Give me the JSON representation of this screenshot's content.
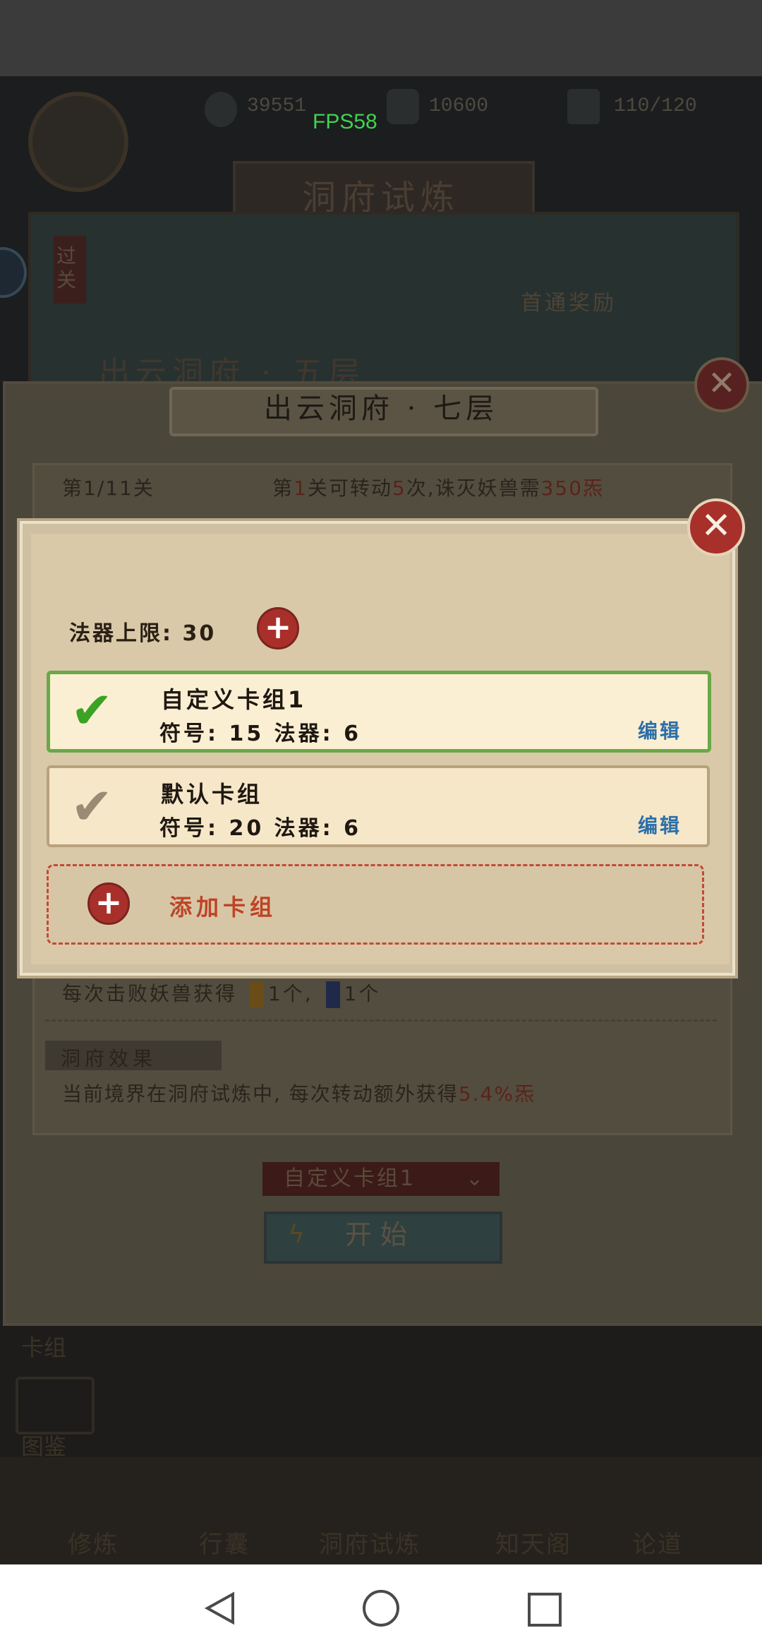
{
  "hud": {
    "fps": "FPS58",
    "spirit_stones": "39551",
    "jade": "10600",
    "stamina": "110/120"
  },
  "background": {
    "title": "洞府试炼",
    "floor_title": "出云洞府 · 五层",
    "first_clear_reward": "首通奖励",
    "side_tag": "过关"
  },
  "trial_dialog": {
    "title": "出云洞府 · 七层",
    "level_counter": "第1/11关",
    "rotate_prefix": "第",
    "rotate_level": "1",
    "rotate_mid": "关可转动",
    "rotate_times": "5",
    "rotate_mid2": "次,诛灭妖兽需",
    "rotate_cost": "350炁",
    "defeat_prefix": "每次击败妖兽获得",
    "defeat_item1": "1个,",
    "defeat_item2": "1个",
    "effect_label": "洞府效果",
    "effect_desc_prefix": "当前境界在洞府试炼中, 每次转动额外获得",
    "effect_desc_value": "5.4%炁",
    "selected_deck": "自定义卡组1",
    "start_label": "开始"
  },
  "bottom_nav": {
    "side_items": [
      "卡组",
      "图鉴"
    ],
    "tabs": [
      "修炼",
      "行囊",
      "洞府试炼",
      "知天阁",
      "论道"
    ]
  },
  "deck_dialog": {
    "limit_label": "法器上限:",
    "limit_value": "30",
    "decks": [
      {
        "name": "自定义卡组1",
        "stats": "符号: 15  法器: 6",
        "edit": "编辑",
        "selected": true
      },
      {
        "name": "默认卡组",
        "stats": "符号: 20  法器: 6",
        "edit": "编辑",
        "selected": false
      }
    ],
    "add_deck_label": "添加卡组"
  },
  "icons": {
    "close": "close-icon",
    "add": "plus-icon",
    "check": "check-icon",
    "back": "back-triangle-icon",
    "home": "home-circle-icon",
    "recent": "recent-square-icon"
  },
  "colors": {
    "accent_red": "#a9302a",
    "selected_green": "#6aa848",
    "edit_blue": "#2c6fa9",
    "add_text": "#bd4427"
  }
}
